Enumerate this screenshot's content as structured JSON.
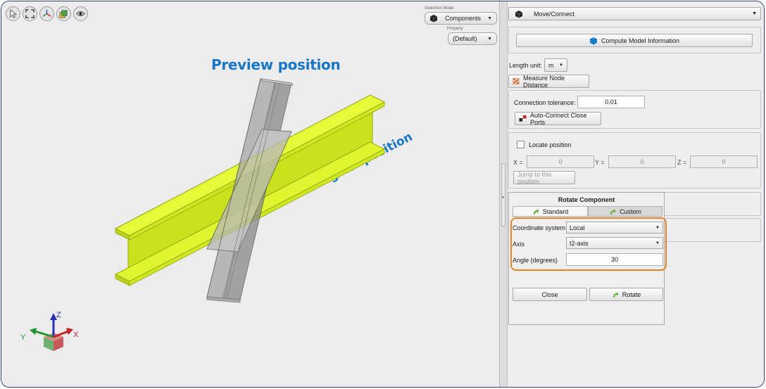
{
  "viewport": {
    "toolbar_icons": [
      "pointer-icon",
      "fit-view-icon",
      "axes-view-icon",
      "layers-icon",
      "eye-icon"
    ],
    "selection_mode_label": "Selection Mode",
    "selection_mode_value": "Components",
    "property_label": "Property",
    "property_value": "(Default)",
    "preview_label": "Preview position",
    "original_label": "Original position",
    "axis_labels": {
      "x": "X",
      "y": "Y",
      "z": "Z"
    },
    "colors": {
      "beam_original": "#d8f41e",
      "beam_preview": "#9d9d9d",
      "annotation": "#1876c9"
    }
  },
  "panel": {
    "mode_value": "Move/Connect",
    "compute_button": "Compute Model Information",
    "length_unit_label": "Length unit:",
    "length_unit_value": "m",
    "measure_button": "Measure Node Distance",
    "tolerance_label": "Connection tolerance:",
    "tolerance_value": "0.01",
    "auto_connect_button": "Auto-Connect Close Ports",
    "locate_label": "Locate position",
    "x_label": "X =",
    "x_value": "0",
    "y_label": "Y =",
    "y_value": "0",
    "z_label": "Z =",
    "z_value": "0",
    "jump_button": "Jump to this position",
    "rotate": {
      "title": "Rotate Component",
      "tab_standard": "Standard",
      "tab_custom": "Custom",
      "coord_label": "Coordinate system",
      "coord_value": "Local",
      "axis_label": "Axis",
      "axis_value": "t2-axis",
      "angle_label": "Angle (degrees)",
      "angle_value": "30",
      "close_button": "Close",
      "rotate_button": "Rotate"
    },
    "highlight_color": "#e8832a"
  }
}
